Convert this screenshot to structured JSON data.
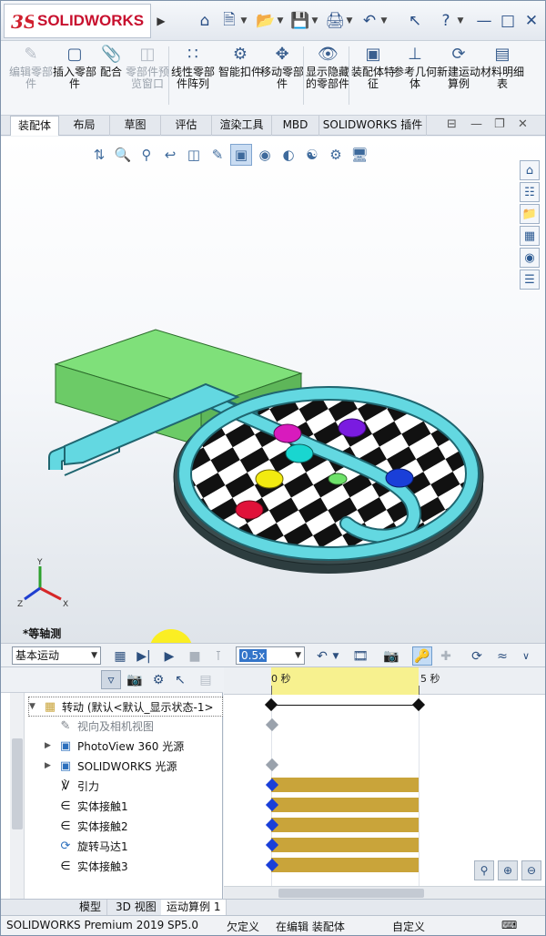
{
  "app": {
    "brand": "SOLIDWORKS",
    "brand_ds": "3S"
  },
  "quick_access": [
    "home-icon",
    "new-document-icon",
    "open-icon",
    "save-icon",
    "print-icon",
    "undo-icon",
    "help-icon",
    "options-icon",
    "close-icon"
  ],
  "commands": [
    {
      "label": "编辑零部件",
      "icon": "edit-component-icon",
      "enabled": false
    },
    {
      "label": "插入零部件",
      "icon": "insert-components-icon",
      "enabled": true
    },
    {
      "label": "配合",
      "icon": "mate-icon",
      "enabled": true
    },
    {
      "label": "零部件预览窗口",
      "icon": "component-preview-icon",
      "enabled": false
    },
    {
      "label": "线性零部件阵列",
      "icon": "linear-pattern-icon",
      "enabled": true
    },
    {
      "label": "智能扣件",
      "icon": "smart-fasteners-icon",
      "enabled": true
    },
    {
      "label": "移动零部件",
      "icon": "move-component-icon",
      "enabled": true
    },
    {
      "label": "显示隐藏的零部件",
      "icon": "show-hidden-icon",
      "enabled": true
    },
    {
      "label": "装配体特征",
      "icon": "assembly-features-icon",
      "enabled": true
    },
    {
      "label": "参考几何体",
      "icon": "reference-geometry-icon",
      "enabled": true
    },
    {
      "label": "新建运动算例",
      "icon": "new-motion-study-icon",
      "enabled": true
    },
    {
      "label": "材料明细表",
      "icon": "bom-icon",
      "enabled": true
    }
  ],
  "tabs": [
    "装配体",
    "布局",
    "草图",
    "评估",
    "渲染工具",
    "MBD",
    "SOLIDWORKS 插件"
  ],
  "viewport": {
    "view_label": "*等轴测"
  },
  "motion_toolbar": {
    "study_type": "基本运动",
    "speed": "0.5x"
  },
  "tree": {
    "root": "转动 (默认<默认_显示状态-1>",
    "items": [
      {
        "label": "视向及相机视图",
        "icon": "camera-icon",
        "dim": true,
        "expand": false
      },
      {
        "label": "PhotoView 360 光源",
        "icon": "photoview-icon",
        "dim": false,
        "expand": true
      },
      {
        "label": "SOLIDWORKS 光源",
        "icon": "lights-icon",
        "dim": false,
        "expand": true
      },
      {
        "label": "引力",
        "icon": "gravity-icon",
        "dim": false,
        "expand": false
      },
      {
        "label": "实体接触1",
        "icon": "contact-icon",
        "dim": false,
        "expand": false
      },
      {
        "label": "实体接触2",
        "icon": "contact-icon",
        "dim": false,
        "expand": false
      },
      {
        "label": "旋转马达1",
        "icon": "rotary-motor-icon",
        "dim": false,
        "expand": false
      },
      {
        "label": "实体接触3",
        "icon": "contact-icon",
        "dim": false,
        "expand": false
      }
    ]
  },
  "timeline": {
    "mark0": "0 秒",
    "mark5": "5 秒",
    "key_color": "#1a3fd8",
    "bar_color": "#c9a43a"
  },
  "bottom_tabs": [
    "模型",
    "3D 视图",
    "运动算例 1"
  ],
  "status": {
    "product": "SOLIDWORKS Premium 2019 SP5.0",
    "defined": "欠定义",
    "editing": "在编辑 装配体",
    "custom": "自定义"
  }
}
